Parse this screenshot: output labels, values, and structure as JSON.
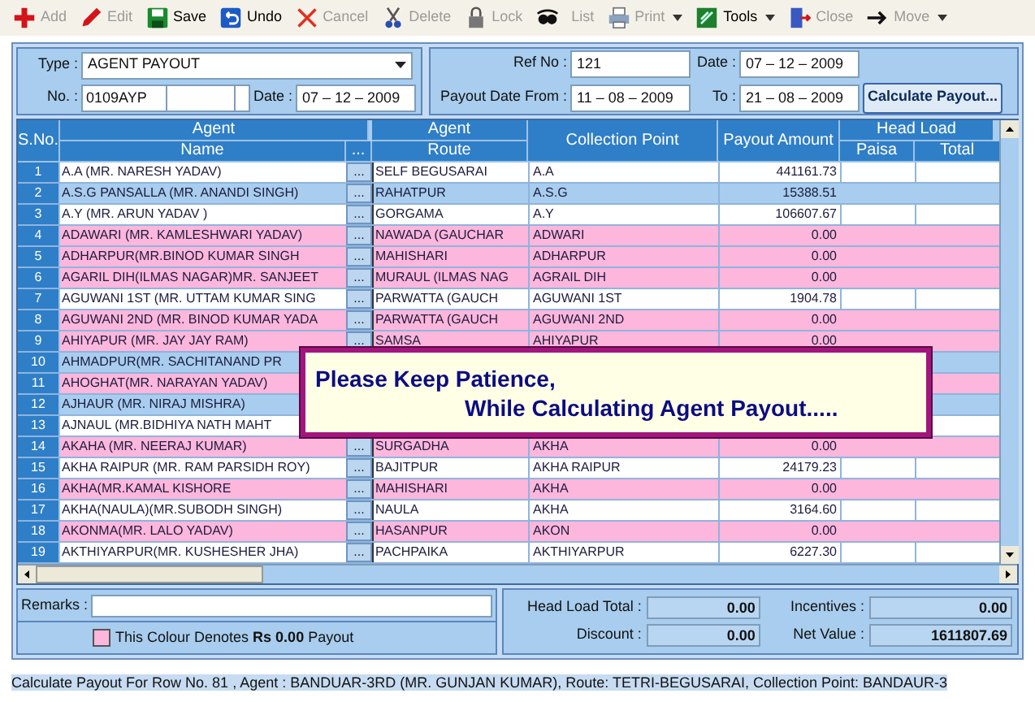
{
  "toolbar": [
    {
      "kind": "plus",
      "label": "Add",
      "disabled": true
    },
    {
      "kind": "pencil",
      "label": "Edit",
      "disabled": true
    },
    {
      "kind": "floppy",
      "label": "Save",
      "disabled": false
    },
    {
      "kind": "undo",
      "label": "Undo",
      "disabled": false
    },
    {
      "kind": "cross",
      "label": "Cancel",
      "disabled": true
    },
    {
      "kind": "scissors",
      "label": "Delete",
      "disabled": true
    },
    {
      "kind": "lock",
      "label": "Lock",
      "disabled": true
    },
    {
      "kind": "glasses"
    },
    {
      "kind": "list",
      "label": "List",
      "disabled": true
    },
    {
      "kind": "printer",
      "label": "Print",
      "disabled": true,
      "dropdown": true
    },
    {
      "kind": "sheet",
      "label": "Tools",
      "disabled": false,
      "dropdown": true
    },
    {
      "kind": "door",
      "label": "Close",
      "disabled": true
    },
    {
      "kind": "arrow",
      "label": "Move",
      "disabled": true,
      "dropdown": true
    }
  ],
  "form": {
    "type": {
      "label": "Type :",
      "value": "AGENT PAYOUT"
    },
    "no": {
      "label": "No. :",
      "value": "0109AYP"
    },
    "date": {
      "label": "Date :",
      "value": "07 – 12 – 2009"
    },
    "ref_no": {
      "label": "Ref No :",
      "value": "121"
    },
    "ref_date": {
      "label": "Date :",
      "value": "07 – 12 – 2009"
    },
    "payout_from": {
      "label": "Payout Date From :",
      "value": "11 – 08 – 2009"
    },
    "payout_to": {
      "label": "To :",
      "value": "21 – 08 – 2009"
    },
    "calculate_button": "Calculate Payout..."
  },
  "table": {
    "groups": [
      "Agent",
      "Agent",
      "Head Load"
    ],
    "columns": [
      "S.No.",
      "Name",
      "...",
      "Route",
      "Collection Point",
      "Payout Amount",
      "Paisa",
      "Total"
    ],
    "rows": [
      {
        "sno": "1",
        "kind": "white",
        "name": "A.A (MR. NARESH YADAV)",
        "route": "SELF BEGUSARAI",
        "point": "A.A",
        "amount": "441161.73"
      },
      {
        "sno": "2",
        "kind": "blue",
        "name": "A.S.G PANSALLA (MR. ANANDI SINGH)",
        "route": "RAHATPUR",
        "point": "A.S.G",
        "amount": "15388.51"
      },
      {
        "sno": "3",
        "kind": "white",
        "name": "A.Y (MR. ARUN YADAV )",
        "route": "GORGAMA",
        "point": "A.Y",
        "amount": "106607.67"
      },
      {
        "sno": "4",
        "kind": "pink",
        "name": "ADAWARI (MR. KAMLESHWARI YADAV)",
        "route": "NAWADA (GAUCHAR",
        "point": "ADWARI",
        "amount": "0.00"
      },
      {
        "sno": "5",
        "kind": "pink",
        "name": "ADHARPUR(MR.BINOD KUMAR SINGH",
        "route": "MAHISHARI",
        "point": "ADHARPUR",
        "amount": "0.00"
      },
      {
        "sno": "6",
        "kind": "pink",
        "name": "AGARIL DIH(ILMAS NAGAR)MR. SANJEET",
        "route": "MURAUL (ILMAS NAG",
        "point": "AGRAIL DIH",
        "amount": "0.00"
      },
      {
        "sno": "7",
        "kind": "white",
        "name": "AGUWANI 1ST (MR. UTTAM KUMAR SING",
        "route": "PARWATTA (GAUCH",
        "point": "AGUWANI 1ST",
        "amount": "1904.78"
      },
      {
        "sno": "8",
        "kind": "pink",
        "name": "AGUWANI 2ND (MR. BINOD KUMAR YADA",
        "route": "PARWATTA (GAUCH",
        "point": "AGUWANI 2ND",
        "amount": "0.00"
      },
      {
        "sno": "9",
        "kind": "pink",
        "name": "AHIYAPUR (MR. JAY JAY RAM)",
        "route": "SAMSA",
        "point": "AHIYAPUR",
        "amount": "0.00"
      },
      {
        "sno": "10",
        "kind": "blue",
        "name": "AHMADPUR(MR. SACHITANAND PR"
      },
      {
        "sno": "11",
        "kind": "pink",
        "name": "AHOGHAT(MR. NARAYAN YADAV)"
      },
      {
        "sno": "12",
        "kind": "blue",
        "name": "AJHAUR (MR. NIRAJ MISHRA)"
      },
      {
        "sno": "13",
        "kind": "white",
        "name": "AJNAUL (MR.BIDHIYA NATH MAHT"
      },
      {
        "sno": "14",
        "kind": "pink",
        "name": "AKAHA (MR. NEERAJ KUMAR)",
        "route": "SURGADHA",
        "point": "AKHA",
        "amount": "0.00"
      },
      {
        "sno": "15",
        "kind": "white",
        "name": "AKHA RAIPUR (MR. RAM PARSIDH ROY)",
        "route": "BAJITPUR",
        "point": "AKHA RAIPUR",
        "amount": "24179.23"
      },
      {
        "sno": "16",
        "kind": "pink",
        "name": "AKHA(MR.KAMAL KISHORE",
        "route": "MAHISHARI",
        "point": "AKHA",
        "amount": "0.00"
      },
      {
        "sno": "17",
        "kind": "white",
        "name": "AKHA(NAULA)(MR.SUBODH SINGH)",
        "route": "NAULA",
        "point": "AKHA",
        "amount": "3164.60"
      },
      {
        "sno": "18",
        "kind": "pink",
        "name": "AKONMA(MR. LALO YADAV)",
        "route": "HASANPUR",
        "point": "AKON",
        "amount": "0.00"
      },
      {
        "sno": "19",
        "kind": "white",
        "name": "AKTHIYARPUR(MR. KUSHESHER JHA)",
        "route": "PACHPAIKA",
        "point": "AKTHIYARPUR",
        "amount": "6227.30"
      }
    ]
  },
  "overlay": [
    "Please Keep Patience,",
    "While Calculating Agent Payout....."
  ],
  "footer": {
    "remarks_label": "Remarks :",
    "legend": "This Colour Denotes **Rs 0.00** Payout",
    "totals": [
      {
        "label": "Head Load Total :",
        "value": "0.00"
      },
      {
        "label": "Incentives :",
        "value": "0.00"
      },
      {
        "label": "Discount :",
        "value": "0.00"
      },
      {
        "label": "Net Value :",
        "value": "1611807.69"
      }
    ]
  },
  "status_bar": "Calculate Payout For Row No. 81 , Agent : BANDUAR-3RD (MR. GUNJAN KUMAR), Route: TETRI-BEGUSARAI, Collection Point: BANDAUR-3"
}
